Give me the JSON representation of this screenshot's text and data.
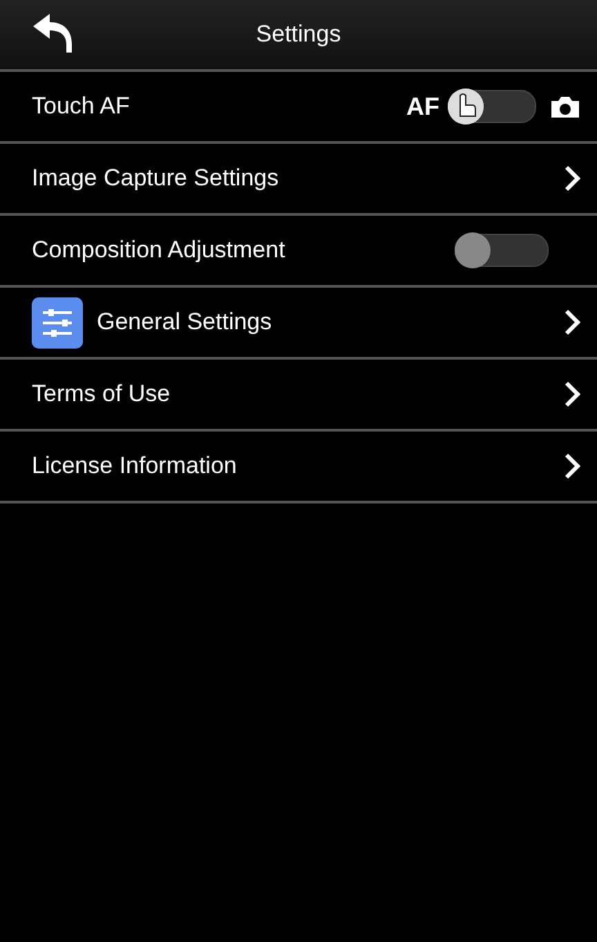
{
  "header": {
    "title": "Settings"
  },
  "rows": [
    {
      "kind": "af-switch",
      "label": "Touch AF",
      "switch_label": "AF",
      "on": false
    },
    {
      "kind": "link",
      "label": "Image Capture Settings"
    },
    {
      "kind": "toggle",
      "label": "Composition Adjustment",
      "on": false
    },
    {
      "kind": "link",
      "label": "General Settings",
      "has_icon": true
    },
    {
      "kind": "link",
      "label": "Terms of Use"
    },
    {
      "kind": "link",
      "label": "License Information"
    }
  ]
}
